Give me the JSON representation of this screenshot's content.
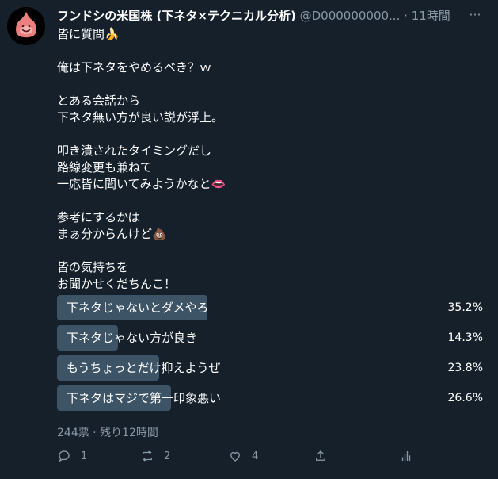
{
  "tweet": {
    "name": "フンドシの米国株 (下ネタ×テクニカル分析)",
    "handle": "@D000000000...",
    "dot": "·",
    "time": "11時間",
    "more_label": "···",
    "lines": [
      {
        "text": "皆に質問",
        "emoji": "🍌"
      },
      {
        "text": ""
      },
      {
        "text": "俺は下ネタをやめるべき？ｗ"
      },
      {
        "text": ""
      },
      {
        "text": "とある会話から"
      },
      {
        "text": "下ネタ無い方が良い説が浮上。"
      },
      {
        "text": ""
      },
      {
        "text": "叩き潰されたタイミングだし"
      },
      {
        "text": "路線変更も兼ねて"
      },
      {
        "text": "一応皆に聞いてみようかなと",
        "emoji": "👄"
      },
      {
        "text": ""
      },
      {
        "text": "参考にするかは"
      },
      {
        "text": "まぁ分からんけど",
        "emoji": "💩"
      },
      {
        "text": ""
      },
      {
        "text": "皆の気持ちを"
      },
      {
        "text": "お聞かせくだちんこ！"
      }
    ]
  },
  "poll": {
    "options": [
      {
        "label": "下ネタじゃないとダメやろ",
        "percent_text": "35.2%",
        "percent": 35.2
      },
      {
        "label": "下ネタじゃない方が良き",
        "percent_text": "14.3%",
        "percent": 14.3
      },
      {
        "label": "もうちょっとだけ抑えようぜ",
        "percent_text": "23.8%",
        "percent": 23.8
      },
      {
        "label": "下ネタはマジで第一印象悪い",
        "percent_text": "26.6%",
        "percent": 26.6
      }
    ],
    "meta": "244票 · 残り12時間"
  },
  "actions": {
    "reply_count": "1",
    "retweet_count": "2",
    "like_count": "4"
  },
  "colors": {
    "background": "#15202b",
    "poll_fill": "#3d5466",
    "secondary_text": "#8899a6"
  }
}
